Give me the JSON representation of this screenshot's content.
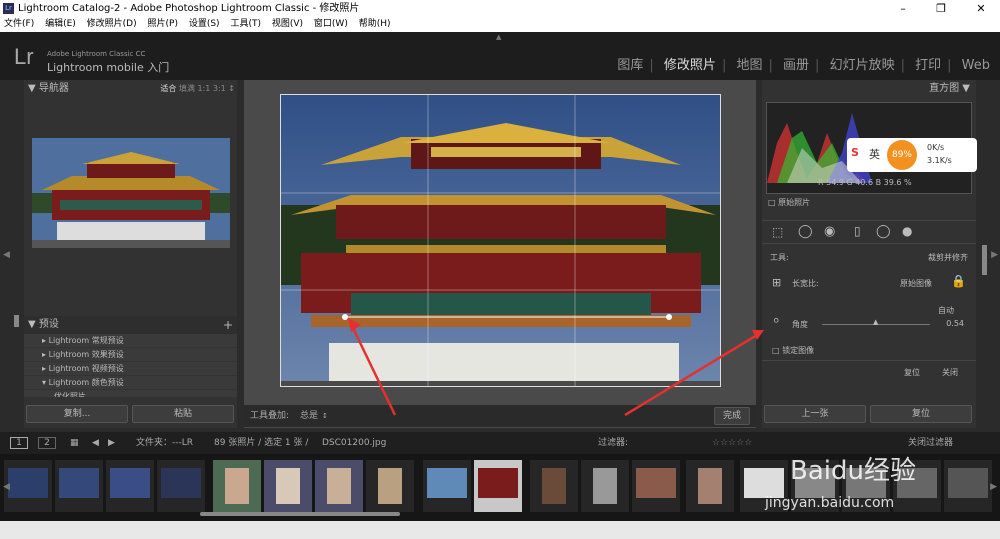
{
  "window": {
    "title": "Lightroom Catalog-2 - Adobe Photoshop Lightroom Classic - 修改照片",
    "app_icon": "Lr"
  },
  "menu": [
    "文件(F)",
    "编辑(E)",
    "修改照片(D)",
    "照片(P)",
    "设置(S)",
    "工具(T)",
    "视图(V)",
    "窗口(W)",
    "帮助(H)"
  ],
  "identity": {
    "logo": "Lr",
    "product": "Adobe Lightroom Classic CC",
    "mobile": "Lightroom mobile 入门"
  },
  "modules": [
    "图库",
    "修改照片",
    "地图",
    "画册",
    "幻灯片放映",
    "打印",
    "Web"
  ],
  "active_module": "修改照片",
  "navigator": {
    "title": "导航器",
    "fit": "适合",
    "fill": "填满",
    "one": "1:1",
    "three": "3:1"
  },
  "presets": {
    "title": "预设",
    "items": [
      "Lightroom 常规预设",
      "Lightroom 效果预设",
      "Lightroom 视频预设",
      "Lightroom 颜色预设",
      "优化照片"
    ]
  },
  "left_buttons": {
    "copy": "复制...",
    "paste": "粘贴"
  },
  "toolbar": {
    "overlay_label": "工具叠加:",
    "overlay_value": "总是",
    "done": "完成"
  },
  "histogram": {
    "title": "直方图",
    "r_label": "R",
    "r_value": "54.9",
    "g_label": "G",
    "g_value": "40.6",
    "b_label": "B",
    "b_value": "39.6",
    "pct": "%",
    "original": "原始照片"
  },
  "crop": {
    "tool_label": "工具:",
    "tool_value": "裁剪并修齐",
    "aspect_label": "长宽比:",
    "aspect_value": "原始图像",
    "auto": "自动",
    "angle_label": "角度",
    "angle_value": "0.54",
    "lock_label": "锁定图像",
    "reset": "复位",
    "close": "关闭"
  },
  "right_buttons": {
    "prev": "上一张",
    "reset": "复位"
  },
  "filmbar": {
    "view1": "1",
    "view2": "2",
    "folder_label": "文件夹：",
    "path": "---LR",
    "count": "89 张照片 / 选定 1 张 /",
    "filename": "DSC01200.jpg",
    "filter_label": "过滤器:",
    "filter_off": "关闭过滤器"
  },
  "sougou": {
    "brand": "英",
    "percent": "89%",
    "up": "0K/s",
    "down": "3.1K/s"
  },
  "watermark": {
    "logo": "Baidu经验",
    "url": "jingyan.baidu.com"
  },
  "colors": {
    "accent": "#e8eaed",
    "sky": "#3b5888",
    "roof": "#c9a23a",
    "wall": "#8b1e1e"
  }
}
